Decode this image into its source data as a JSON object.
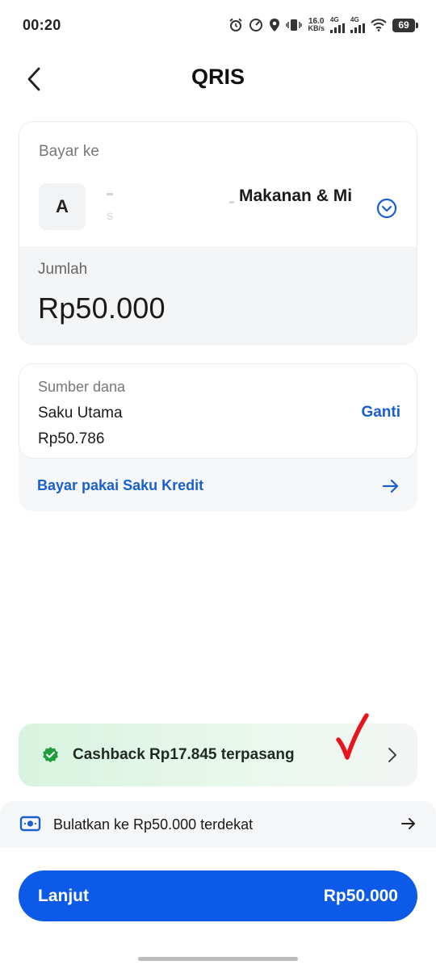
{
  "status_bar": {
    "time": "00:20",
    "net_speed_value": "16.0",
    "net_speed_unit": "KB/s",
    "signal1_tag": "4G",
    "signal2_tag": "4G",
    "battery": "69"
  },
  "header": {
    "title": "QRIS"
  },
  "pay_to": {
    "label": "Bayar ke",
    "merchant_initial": "A",
    "merchant_name": "Makanan & Mi",
    "merchant_obscured_char": "S"
  },
  "amount": {
    "label": "Jumlah",
    "value": "Rp50.000"
  },
  "source": {
    "label": "Sumber dana",
    "name": "Saku Utama",
    "balance": "Rp50.786",
    "change_label": "Ganti",
    "credit_link": "Bayar pakai Saku Kredit"
  },
  "cashback": {
    "text": "Cashback Rp17.845 terpasang"
  },
  "rounding": {
    "text": "Bulatkan ke Rp50.000 terdekat"
  },
  "continue": {
    "label": "Lanjut",
    "amount": "Rp50.000"
  },
  "colors": {
    "accent_blue": "#0d59e8",
    "link_blue": "#1a5fd0",
    "success_green": "#1f9d3a",
    "annotation_red": "#e8141c"
  }
}
